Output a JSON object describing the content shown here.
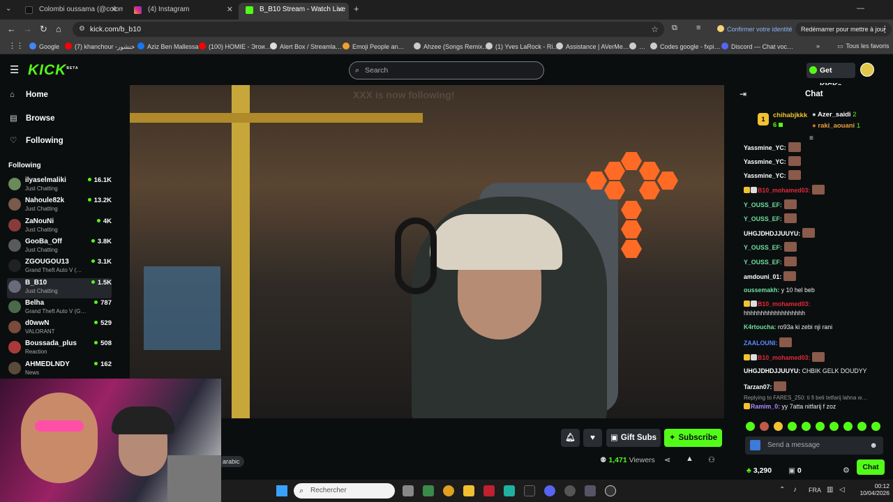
{
  "browser": {
    "tabs": [
      {
        "title": "Colombi oussama (@colom…",
        "active": false
      },
      {
        "title": "(4) Instagram",
        "active": false
      },
      {
        "title": "B_B10 Stream - Watch Live",
        "active": true
      }
    ],
    "url": "kick.com/b_b10",
    "identity": "Confirmer votre identité",
    "restart": "Redémarrer pour mettre à jour",
    "bookmarks": [
      "Google",
      "(7) khanchour -خنشور",
      "Aziz Ben Mallessa",
      "(100) HOMIE - Эгои…",
      "Alert Box / Streamla…",
      "Emoji People an…",
      "Ahzee (Songs Remix…",
      "(1) Yves LaRock - Ri…",
      "Assistance | AVerMe…",
      "Codes google - fxpi…",
      "Discord — Chat voc…"
    ],
    "all_bookmarks": "Tous les favoris"
  },
  "header": {
    "logo": "KICK",
    "logo_sup": "BETA",
    "search_placeholder": "Search",
    "get_kicks": "Get KICKs"
  },
  "nav": {
    "home": "Home",
    "browse": "Browse",
    "following": "Following",
    "following_heading": "Following"
  },
  "following": [
    {
      "name": "ilyaselmaliki",
      "category": "Just Chatting",
      "viewers": "16.1K",
      "color": "#6a8a5a"
    },
    {
      "name": "Nahoule82k",
      "category": "Just Chatting",
      "viewers": "13.2K",
      "color": "#7a5a4a"
    },
    {
      "name": "ZaNouNi",
      "category": "Just Chatting",
      "viewers": "4K",
      "color": "#8a3a3a"
    },
    {
      "name": "GooBa_Off",
      "category": "Just Chatting",
      "viewers": "3.8K",
      "color": "#5a5a5a"
    },
    {
      "name": "ZGOUGOU13",
      "category": "Grand Theft Auto V (…",
      "viewers": "3.1K",
      "color": "#222222"
    },
    {
      "name": "B_B10",
      "category": "Just Chatting",
      "viewers": "1.5K",
      "color": "#6a6a7a"
    },
    {
      "name": "Belha",
      "category": "Grand Theft Auto V (G…",
      "viewers": "787",
      "color": "#4a6a4a"
    },
    {
      "name": "d0wwN",
      "category": "VALORANT",
      "viewers": "529",
      "color": "#7a4a3a"
    },
    {
      "name": "Boussada_plus",
      "category": "Reaction",
      "viewers": "508",
      "color": "#aa3a3a"
    },
    {
      "name": "AHMEDLNDY",
      "category": "News",
      "viewers": "162",
      "color": "#5a4a3a"
    }
  ],
  "video": {
    "overlay_text": "XXX is now following!"
  },
  "below": {
    "gift_subs": "Gift Subs",
    "subscribe": "Subscribe",
    "tag": "arabic",
    "viewers_count": "1,471",
    "viewers_label": "Viewers"
  },
  "chat": {
    "title": "Chat",
    "leaders": [
      {
        "rank": "1",
        "name": "chihabjkkk",
        "count": "6"
      },
      {
        "name": "Azer_saidi",
        "count": "2"
      },
      {
        "name": "raki_aouani",
        "count": "1"
      }
    ],
    "messages": [
      {
        "user": "Yassmine_YC:",
        "text": "",
        "color": "#ffffff",
        "emote": true
      },
      {
        "user": "Yassmine_YC:",
        "text": "",
        "color": "#ffffff",
        "emote": true
      },
      {
        "user": "Yassmine_YC:",
        "text": "",
        "color": "#ffffff",
        "emote": true
      },
      {
        "user": "B10_mohamed03:",
        "text": "",
        "color": "#e02a3a",
        "emote": true,
        "badges": true
      },
      {
        "user": "Y_OUSS_EF:",
        "text": "",
        "color": "#6fe0a0",
        "emote": true
      },
      {
        "user": "Y_OUSS_EF:",
        "text": "",
        "color": "#6fe0a0",
        "emote": true
      },
      {
        "user": "UHGJDHDJJUUYU:",
        "text": "",
        "color": "#ffffff",
        "emote": true
      },
      {
        "user": "Y_OUSS_EF:",
        "text": "",
        "color": "#6fe0a0",
        "emote": true
      },
      {
        "user": "Y_OUSS_EF:",
        "text": "",
        "color": "#6fe0a0",
        "emote": true
      },
      {
        "user": "amdouni_01:",
        "text": "",
        "color": "#ffffff",
        "emote": true
      },
      {
        "user": "oussemakh:",
        "text": " y 10 hel beb",
        "color": "#6fe0a0",
        "emote": false
      },
      {
        "user": "B10_mohamed03:",
        "text": "",
        "color": "#e02a3a",
        "emote": false,
        "badges": true
      },
      {
        "user": "",
        "text": "hhhhhhhhhhhhhhhhhh",
        "color": "#ffffff",
        "emote": false
      },
      {
        "user": "K4rtoucha:",
        "text": " ro93a ki zebi nji rani",
        "color": "#6fe0a0",
        "emote": false
      },
      {
        "user": "ZAALOUNI:",
        "text": "",
        "color": "#5a8aff",
        "emote": true
      },
      {
        "user": "B10_mohamed03:",
        "text": "",
        "color": "#e02a3a",
        "emote": true,
        "badges": true
      },
      {
        "user": "UHGJDHDJJUUYU:",
        "text": " CHBIK GELK DOUDYY",
        "color": "#ffffff",
        "emote": false
      },
      {
        "user": "Tarzan07:",
        "text": "",
        "color": "#ffffff",
        "emote": true
      }
    ],
    "reply_note": "Replying to FARES_250: ti fi beli tetfarij lahna w…",
    "reply_user": "Ramim_0:",
    "reply_text": " yy 7atta nitfarij f zoz",
    "send_placeholder": "Send a message",
    "kicks": "3,290",
    "gifts": "0",
    "chat_button": "Chat"
  },
  "taskbar": {
    "search": "Rechercher",
    "lang": "FRA",
    "time": "00:12",
    "date": "10/04/2026"
  }
}
